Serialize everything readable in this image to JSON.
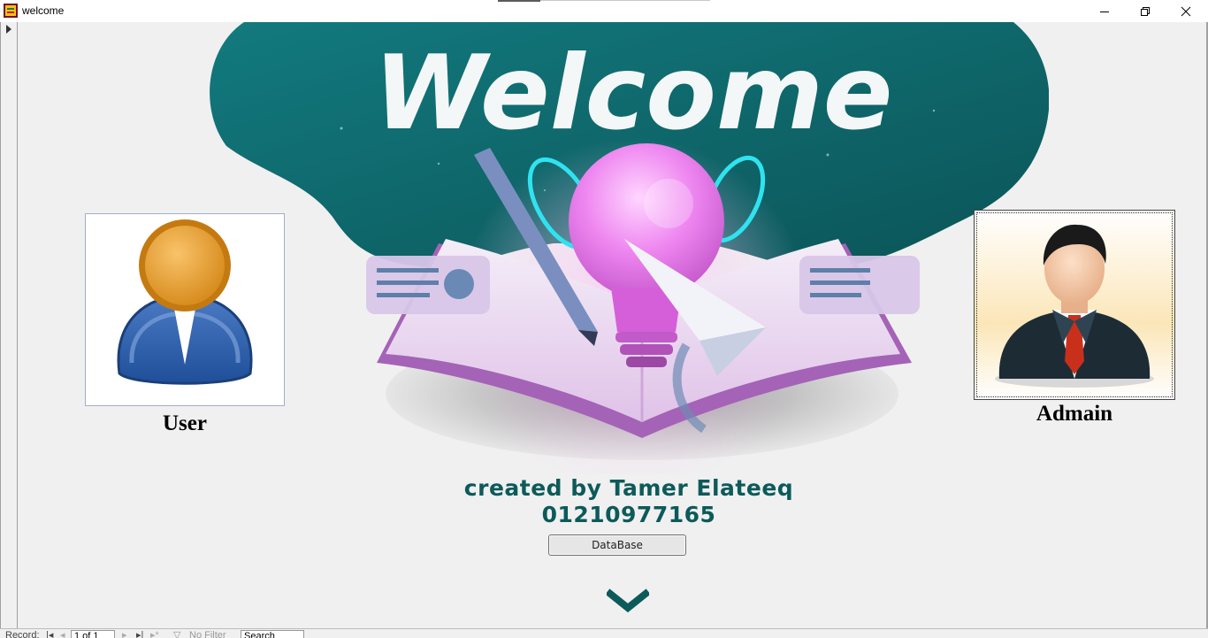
{
  "window": {
    "title": "welcome",
    "minimize_glyph": "—",
    "restore_glyph": "❐",
    "close_glyph": "✕"
  },
  "hero": {
    "heading": "Welcome"
  },
  "user": {
    "caption": "User"
  },
  "admin": {
    "caption": "Admain"
  },
  "credit": {
    "line1": "created by Tamer Elateeq",
    "line2": "01210977165"
  },
  "database_button": {
    "label": "DataBase"
  },
  "record_nav": {
    "record_label": "Record:",
    "position": "1 of 1",
    "filter_label": "No Filter",
    "search_label": "Search"
  },
  "colors": {
    "teal_dark": "#0d5a5a",
    "teal_hero": "#0f6f73",
    "lightbulb": "#e36fe6",
    "book": "#a869b8"
  }
}
